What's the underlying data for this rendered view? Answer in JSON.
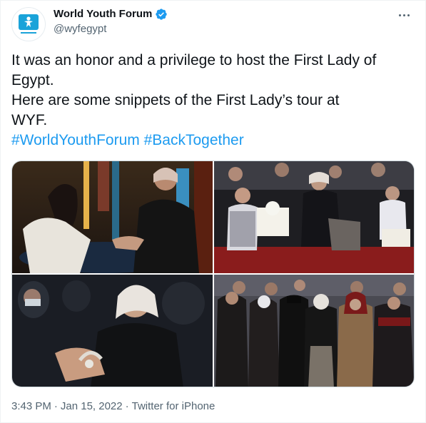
{
  "colors": {
    "accent": "#1d9bf0",
    "text": "#0f1419",
    "muted": "#536471",
    "logo": "#1aa3d9"
  },
  "author": {
    "display_name": "World Youth Forum",
    "handle": "@wyfegypt",
    "verified_icon": "verified-badge-icon",
    "avatar_icon": "wyf-logo-icon"
  },
  "tweet": {
    "line1": "It was an honor and a privilege to host the First Lady of",
    "line2": "Egypt.",
    "line3": "Here are some snippets of the First Lady’s tour at",
    "line4": "WYF.",
    "hashtag1": "#WorldYouthForum",
    "hashtag2": "#BackTogether"
  },
  "media": {
    "photos": [
      {
        "desc_icon": "photo-1"
      },
      {
        "desc_icon": "photo-2"
      },
      {
        "desc_icon": "photo-3"
      },
      {
        "desc_icon": "photo-4"
      }
    ]
  },
  "meta": {
    "time": "3:43 PM",
    "sep1": "·",
    "date": "Jan 15, 2022",
    "sep2": "·",
    "source": "Twitter for iPhone"
  },
  "more_icon": "more-horizontal-icon"
}
